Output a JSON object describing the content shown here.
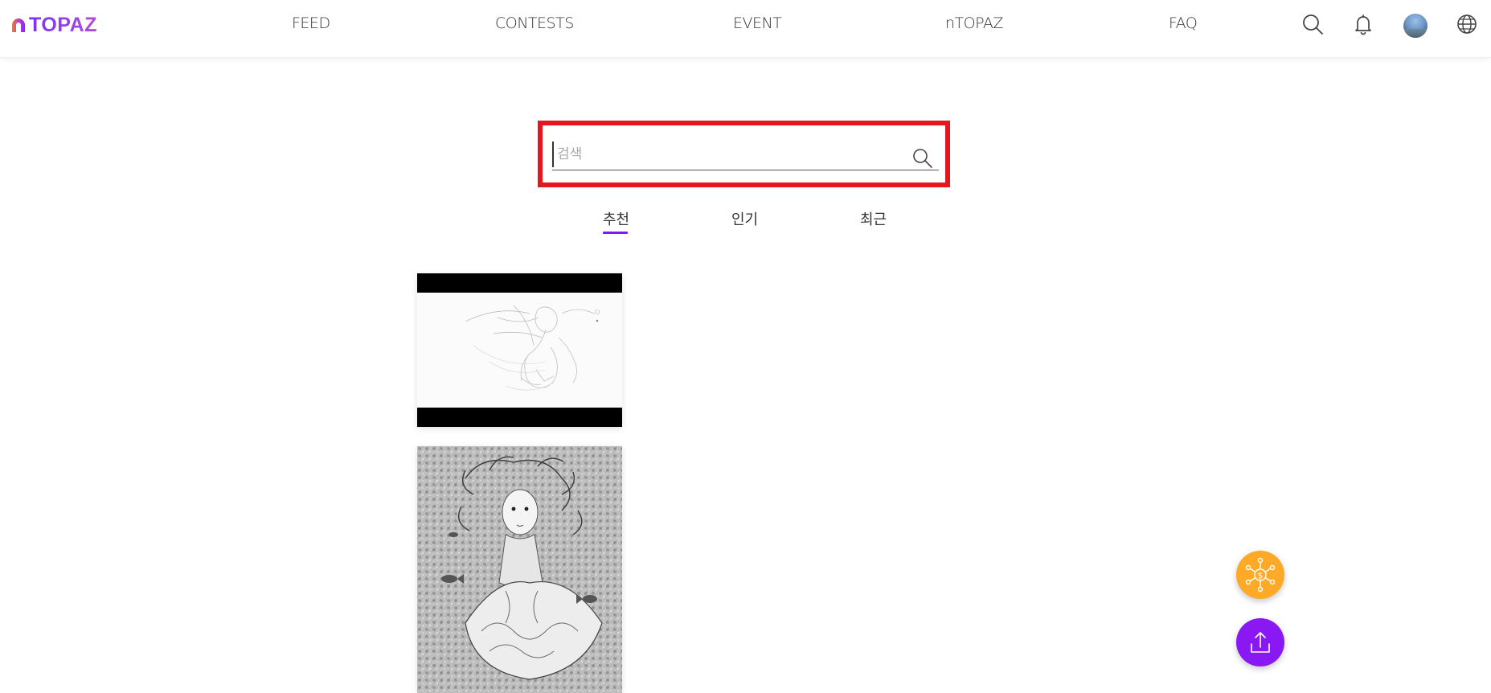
{
  "header": {
    "logo_text": "TOPAZ",
    "nav": [
      {
        "label": "FEED"
      },
      {
        "label": "CONTESTS"
      },
      {
        "label": "EVENT"
      },
      {
        "label": "nTOPAZ"
      },
      {
        "label": "FAQ"
      }
    ],
    "icons": [
      "search-icon",
      "bell-icon",
      "avatar",
      "globe-icon"
    ]
  },
  "search": {
    "placeholder": "검색",
    "value": ""
  },
  "tabs": [
    {
      "label": "추천",
      "active": true
    },
    {
      "label": "인기",
      "active": false
    },
    {
      "label": "최근",
      "active": false
    }
  ],
  "feed": {
    "items": [
      {
        "type": "artwork",
        "description_icon": "sketch-image"
      },
      {
        "type": "artwork",
        "description_icon": "sketch-image"
      }
    ]
  },
  "fabs": [
    {
      "icon": "token-network-icon",
      "color": "#ffa928"
    },
    {
      "icon": "upload-icon",
      "color": "#8a18f2"
    }
  ],
  "colors": {
    "brand_purple": "#7b1cf0",
    "highlight_red": "#e5161e",
    "orange": "#ffa928"
  }
}
